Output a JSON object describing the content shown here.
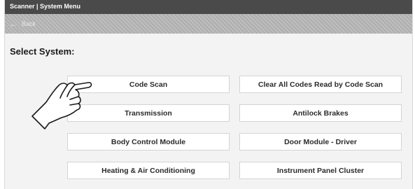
{
  "window": {
    "title": "Scanner | System Menu"
  },
  "nav": {
    "back_label": "Back"
  },
  "heading": "Select System:",
  "systems": [
    {
      "label": "Code Scan"
    },
    {
      "label": "Clear All Codes Read by Code Scan"
    },
    {
      "label": "Transmission"
    },
    {
      "label": "Antilock Brakes"
    },
    {
      "label": "Body Control Module"
    },
    {
      "label": "Door Module - Driver"
    },
    {
      "label": "Heating & Air Conditioning"
    },
    {
      "label": "Instrument Panel Cluster"
    }
  ],
  "icons": {
    "back": "back-arrow-icon",
    "pointer": "pointing-hand-icon"
  },
  "colors": {
    "title_bar": "#4a4a4a",
    "nav_bar": "#b5b5b5",
    "button_bg": "#ffffff",
    "screen_bg": "#f3f3f3"
  }
}
